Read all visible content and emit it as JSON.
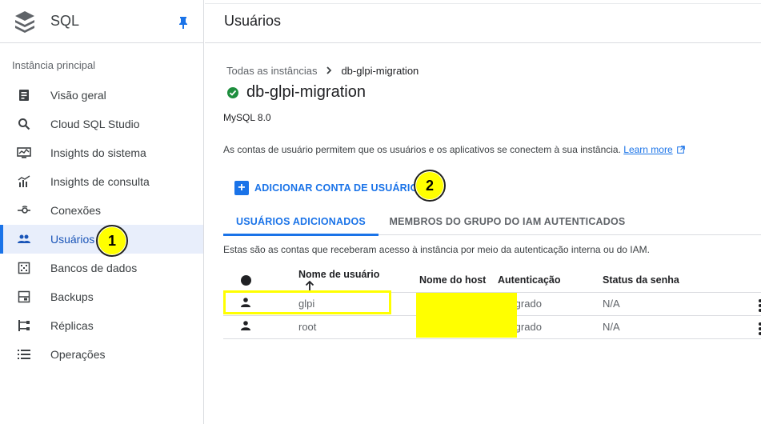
{
  "sidebar": {
    "product_title": "SQL",
    "section_label": "Instância principal",
    "items": [
      {
        "label": "Visão geral",
        "icon": "overview-icon"
      },
      {
        "label": "Cloud SQL Studio",
        "icon": "search-icon"
      },
      {
        "label": "Insights do sistema",
        "icon": "monitor-icon"
      },
      {
        "label": "Insights de consulta",
        "icon": "chart-icon"
      },
      {
        "label": "Conexões",
        "icon": "connections-icon"
      },
      {
        "label": "Usuários",
        "icon": "users-icon",
        "active": true
      },
      {
        "label": "Bancos de dados",
        "icon": "database-icon"
      },
      {
        "label": "Backups",
        "icon": "backups-icon"
      },
      {
        "label": "Réplicas",
        "icon": "replicas-icon"
      },
      {
        "label": "Operações",
        "icon": "list-icon"
      }
    ]
  },
  "header": {
    "title": "Usuários"
  },
  "breadcrumb": {
    "parent": "Todas as instâncias",
    "current": "db-glpi-migration"
  },
  "instance": {
    "name": "db-glpi-migration",
    "version": "MySQL 8.0",
    "status": "ok"
  },
  "description": {
    "text": "As contas de usuário permitem que os usuários e os aplicativos se conectem à sua instância.",
    "link": "Learn more"
  },
  "actions": {
    "add_user": "ADICIONAR CONTA DE USUÁRIO"
  },
  "tabs": [
    "USUÁRIOS ADICIONADOS",
    "MEMBROS DO GRUPO DO IAM AUTENTICADOS"
  ],
  "tab_description": "Estas são as contas que receberam acesso à instância por meio da autenticação interna ou do IAM.",
  "table": {
    "columns": [
      "Nome de usuário",
      "Nome do host",
      "Autenticação",
      "Status da senha"
    ],
    "rows": [
      {
        "username": "glpi",
        "host": "",
        "auth": "Integrado",
        "password_status": "N/A"
      },
      {
        "username": "root",
        "host": "",
        "auth": "Integrado",
        "password_status": "N/A"
      }
    ]
  },
  "annotations": {
    "badge1": "1",
    "badge2": "2"
  },
  "colors": {
    "accent": "#1a73e8",
    "highlight": "#ffff00",
    "success": "#1e8e3e"
  }
}
